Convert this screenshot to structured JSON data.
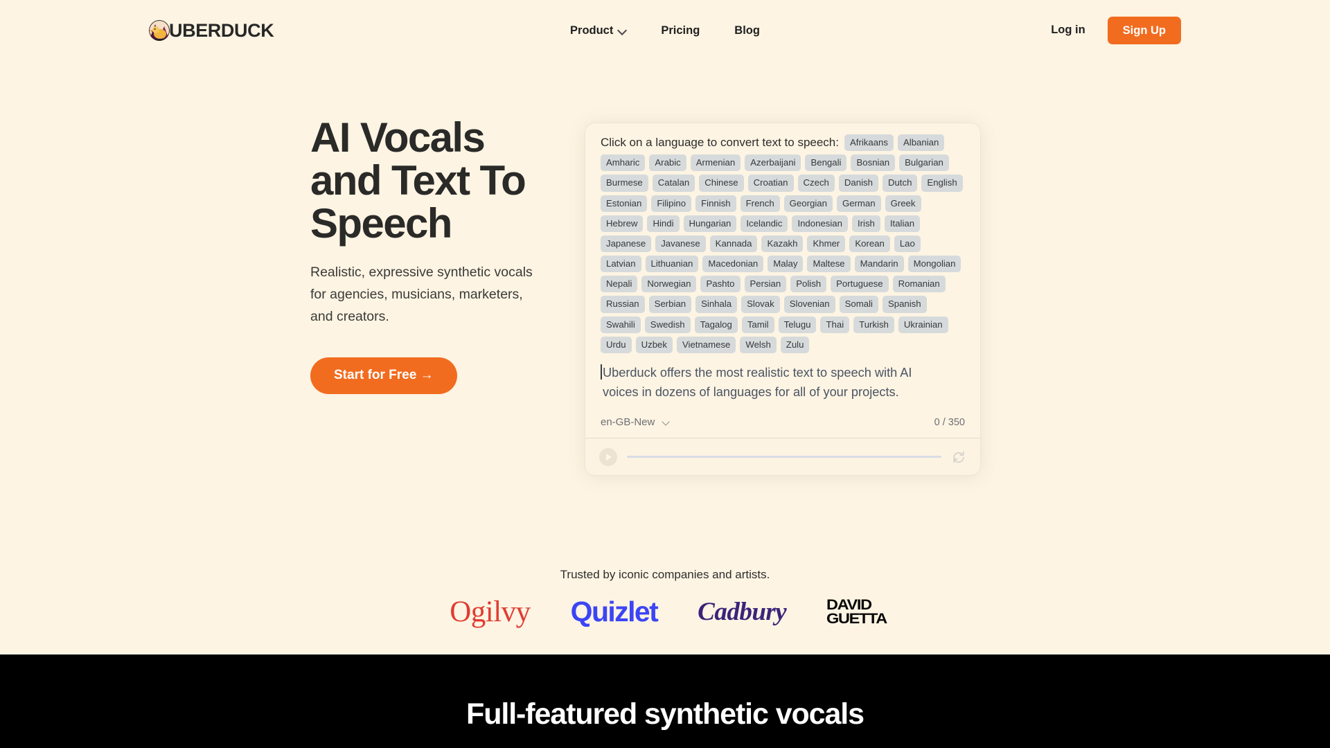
{
  "header": {
    "brand_name": "UBERDUCK",
    "nav": [
      {
        "label": "Product",
        "has_dropdown": true
      },
      {
        "label": "Pricing",
        "has_dropdown": false
      },
      {
        "label": "Blog",
        "has_dropdown": false
      }
    ],
    "login_label": "Log in",
    "signup_label": "Sign Up",
    "accent_color": "#f26c1f"
  },
  "hero": {
    "title_line1": "AI Vocals",
    "title_line2": "and Text To",
    "title_line3": "Speech",
    "subtitle": "Realistic, expressive synthetic vocals for agencies, musicians, marketers, and creators.",
    "cta_label": "Start for Free →"
  },
  "tts": {
    "prompt": "Click on a language to convert text to speech:",
    "languages": [
      "Afrikaans",
      "Albanian",
      "Amharic",
      "Arabic",
      "Armenian",
      "Azerbaijani",
      "Bengali",
      "Bosnian",
      "Bulgarian",
      "Burmese",
      "Catalan",
      "Chinese",
      "Croatian",
      "Czech",
      "Danish",
      "Dutch",
      "English",
      "Estonian",
      "Filipino",
      "Finnish",
      "French",
      "Georgian",
      "German",
      "Greek",
      "Hebrew",
      "Hindi",
      "Hungarian",
      "Icelandic",
      "Indonesian",
      "Irish",
      "Italian",
      "Japanese",
      "Javanese",
      "Kannada",
      "Kazakh",
      "Khmer",
      "Korean",
      "Lao",
      "Latvian",
      "Lithuanian",
      "Macedonian",
      "Malay",
      "Maltese",
      "Mandarin",
      "Mongolian",
      "Nepali",
      "Norwegian",
      "Pashto",
      "Persian",
      "Polish",
      "Portuguese",
      "Romanian",
      "Russian",
      "Serbian",
      "Sinhala",
      "Slovak",
      "Slovenian",
      "Somali",
      "Spanish",
      "Swahili",
      "Swedish",
      "Tagalog",
      "Tamil",
      "Telugu",
      "Thai",
      "Turkish",
      "Ukrainian",
      "Urdu",
      "Uzbek",
      "Vietnamese",
      "Welsh",
      "Zulu"
    ],
    "text_value": "Uberduck offers the most realistic text to speech with AI voices in dozens of languages for all of your projects.",
    "voice_selected": "en-GB-New",
    "char_count": "0 / 350",
    "player": {
      "progress_percent": 0
    }
  },
  "trusted": {
    "label": "Trusted by iconic companies and artists.",
    "logos": [
      {
        "name": "Ogilvy",
        "color": "#e13c32"
      },
      {
        "name": "Quizlet",
        "color": "#3b45f5"
      },
      {
        "name": "Cadbury",
        "color": "#3b2379"
      },
      {
        "name": "DAVID",
        "name2": "GUETTA",
        "color": "#080808"
      }
    ]
  },
  "features_section": {
    "heading": "Full-featured synthetic vocals"
  }
}
